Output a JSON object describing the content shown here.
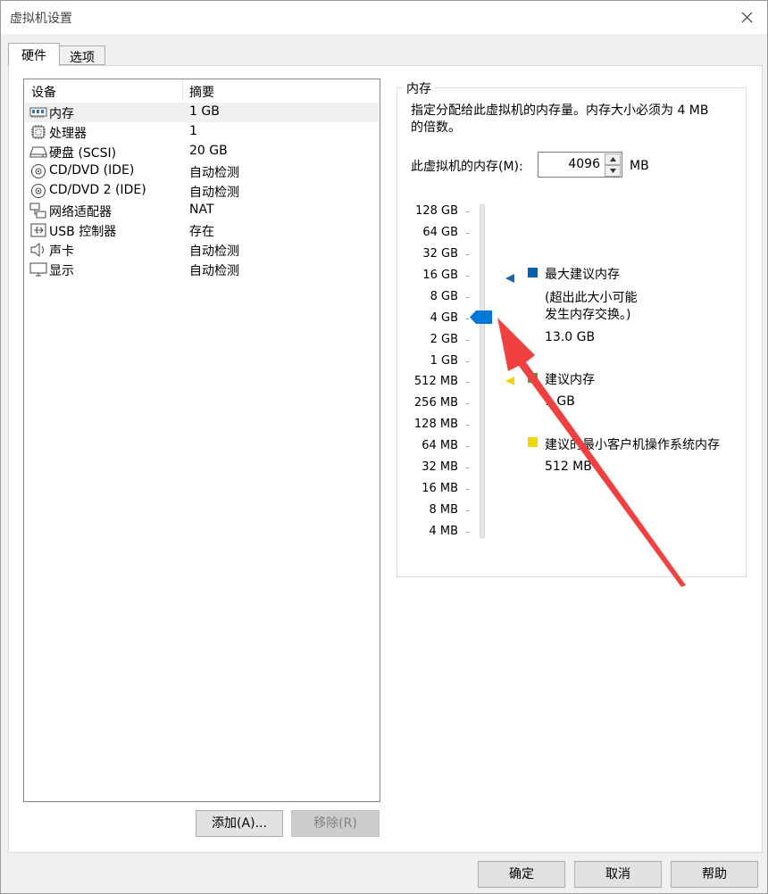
{
  "window": {
    "title": "虚拟机设置"
  },
  "tabs": [
    {
      "label": "硬件"
    },
    {
      "label": "选项"
    }
  ],
  "device_list": {
    "headers": {
      "device": "设备",
      "summary": "摘要"
    },
    "items": [
      {
        "name": "内存",
        "summary": "1 GB",
        "icon": "memory-icon"
      },
      {
        "name": "处理器",
        "summary": "1",
        "icon": "processor-icon"
      },
      {
        "name": "硬盘 (SCSI)",
        "summary": "20 GB",
        "icon": "hard-disk-icon"
      },
      {
        "name": "CD/DVD (IDE)",
        "summary": "自动检测",
        "icon": "cd-dvd-icon"
      },
      {
        "name": "CD/DVD 2 (IDE)",
        "summary": "自动检测",
        "icon": "cd-dvd-icon"
      },
      {
        "name": "网络适配器",
        "summary": "NAT",
        "icon": "network-adapter-icon"
      },
      {
        "name": "USB 控制器",
        "summary": "存在",
        "icon": "usb-icon"
      },
      {
        "name": "声卡",
        "summary": "自动检测",
        "icon": "sound-card-icon"
      },
      {
        "name": "显示",
        "summary": "自动检测",
        "icon": "display-icon"
      }
    ]
  },
  "list_buttons": {
    "add": "添加(A)...",
    "remove": "移除(R)"
  },
  "memory": {
    "group_title": "内存",
    "description_line1": "指定分配给此虚拟机的内存量。内存大小必须为 4 MB",
    "description_line2": "的倍数。",
    "field_label": "此虚拟机的内存(M):",
    "value": "4096",
    "unit": "MB",
    "scale": [
      "128 GB",
      "64 GB",
      "32 GB",
      "16 GB",
      "8 GB",
      "4 GB",
      "2 GB",
      "1 GB",
      "512 MB",
      "256 MB",
      "128 MB",
      "64 MB",
      "32 MB",
      "16 MB",
      "8 MB",
      "4 MB"
    ],
    "max_recommended": {
      "title": "最大建议内存",
      "note_line1": "(超出此大小可能",
      "note_line2": "发生内存交换。)",
      "value": "13.0 GB",
      "color": "#0063b1"
    },
    "recommended": {
      "title": "建议内存",
      "value": "1 GB",
      "color": "#4c9a2a"
    },
    "min_guest": {
      "title": "建议的最小客户机操作系统内存",
      "value": "512 MB",
      "color": "#f2d600"
    }
  },
  "footer_buttons": {
    "ok": "确定",
    "cancel": "取消",
    "help": "帮助"
  },
  "annotation": {
    "color": "#f04040"
  }
}
